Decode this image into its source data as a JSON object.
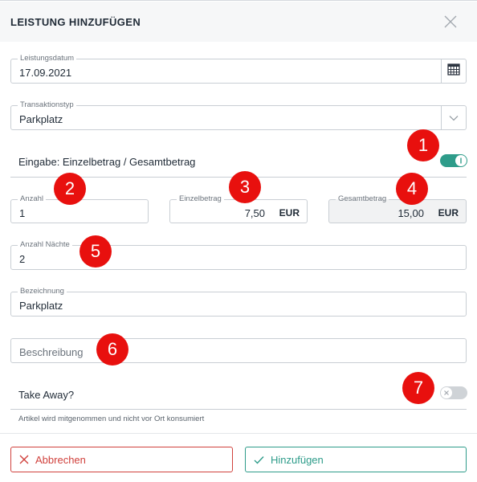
{
  "header": {
    "title": "LEISTUNG HINZUFÜGEN"
  },
  "leistungsdatum": {
    "label": "Leistungsdatum",
    "value": "17.09.2021"
  },
  "transaktionstyp": {
    "label": "Transaktionstyp",
    "value": "Parkplatz"
  },
  "eingabe": {
    "label": "Eingabe: Einzelbetrag / Gesamtbetrag",
    "toggle_on": true
  },
  "anzahl": {
    "label": "Anzahl",
    "value": "1"
  },
  "einzelbetrag": {
    "label": "Einzelbetrag",
    "value": "7,50",
    "unit": "EUR"
  },
  "gesamtbetrag": {
    "label": "Gesamtbetrag",
    "value": "15,00",
    "unit": "EUR"
  },
  "anzahl_naechte": {
    "label": "Anzahl Nächte",
    "value": "2"
  },
  "bezeichnung": {
    "label": "Bezeichnung",
    "value": "Parkplatz"
  },
  "beschreibung": {
    "placeholder": "Beschreibung"
  },
  "take_away": {
    "label": "Take Away?",
    "toggle_on": false,
    "hint": "Artikel wird mitgenommen und nicht vor Ort konsumiert"
  },
  "buttons": {
    "cancel": "Abbrechen",
    "add": "Hinzufügen"
  },
  "markers": [
    "1",
    "2",
    "3",
    "4",
    "5",
    "6",
    "7"
  ],
  "colors": {
    "accent": "#2e9c8a",
    "danger": "#d0413c",
    "marker": "#e8100e"
  },
  "icons": [
    "close-icon",
    "calendar-icon",
    "chevron-down-icon",
    "toggle-on-icon",
    "toggle-off-x-icon",
    "x-icon",
    "check-icon"
  ]
}
